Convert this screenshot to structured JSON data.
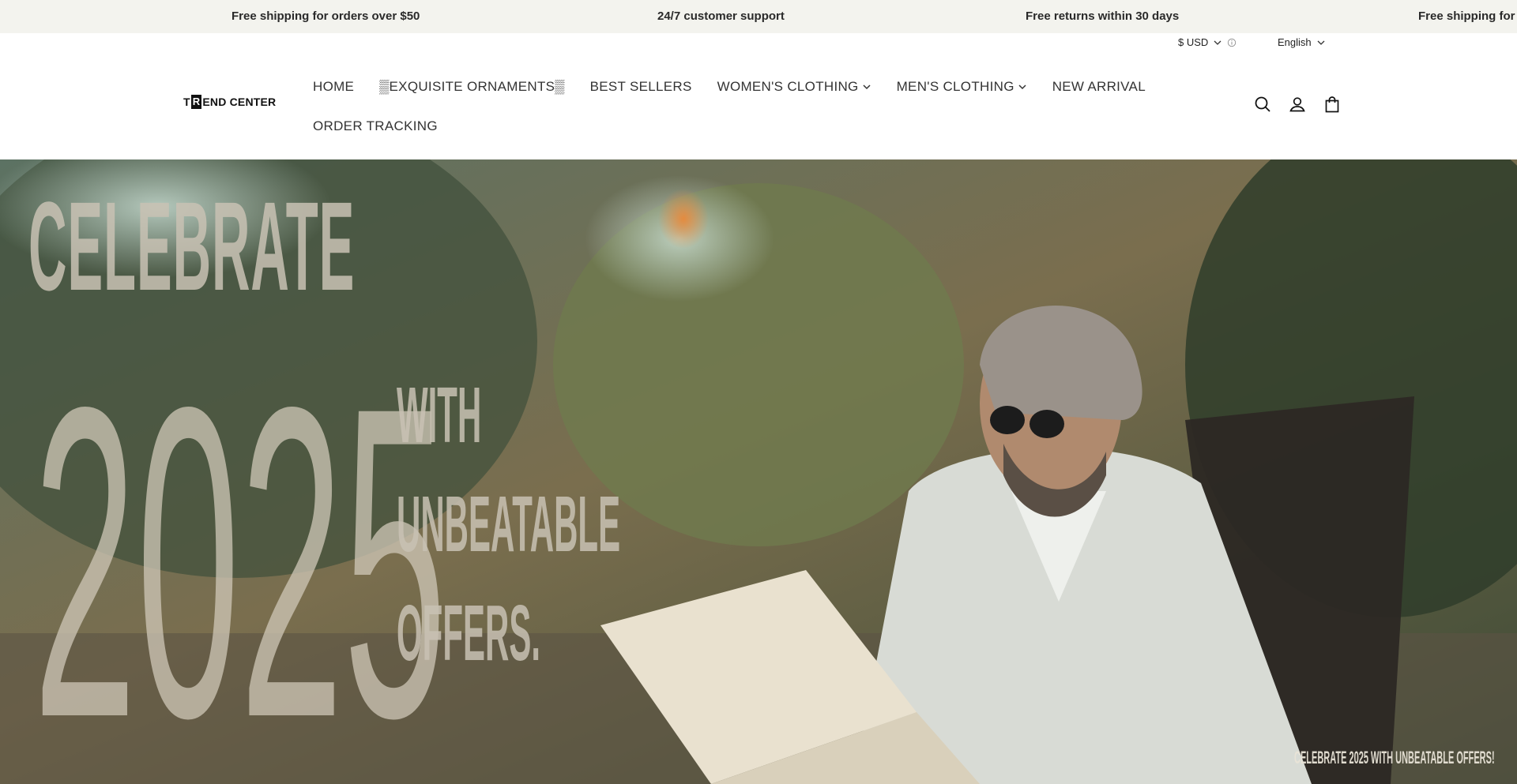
{
  "announcements": [
    "Free shipping for orders over $50",
    "24/7 customer support",
    "Free returns within 30 days",
    "Free shipping for"
  ],
  "utility": {
    "currency": "$ USD",
    "language": "English"
  },
  "logo": {
    "first": "T",
    "box": "R",
    "rest": "END CENTER"
  },
  "nav": {
    "home": "HOME",
    "ornaments": "▒EXQUISITE ORNAMENTS▒",
    "best_sellers": "BEST SELLERS",
    "womens": "WOMEN'S CLOTHING",
    "mens": "MEN'S CLOTHING",
    "new_arrival": "NEW ARRIVAL",
    "order_tracking": "ORDER TRACKING"
  },
  "header_icons": [
    "search-icon",
    "account-icon",
    "cart-icon"
  ],
  "hero": {
    "line1": "CELEBRATE",
    "year": "2025",
    "line2": "WITH",
    "line3": "UNBEATABLE",
    "line4": "OFFERS.",
    "stamp": "CELEBRATE 2025 WITH UNBEATABLE OFFERS!"
  },
  "colors": {
    "announce_bg": "#f3f3ee",
    "hero_text": "#c9c2b4"
  }
}
